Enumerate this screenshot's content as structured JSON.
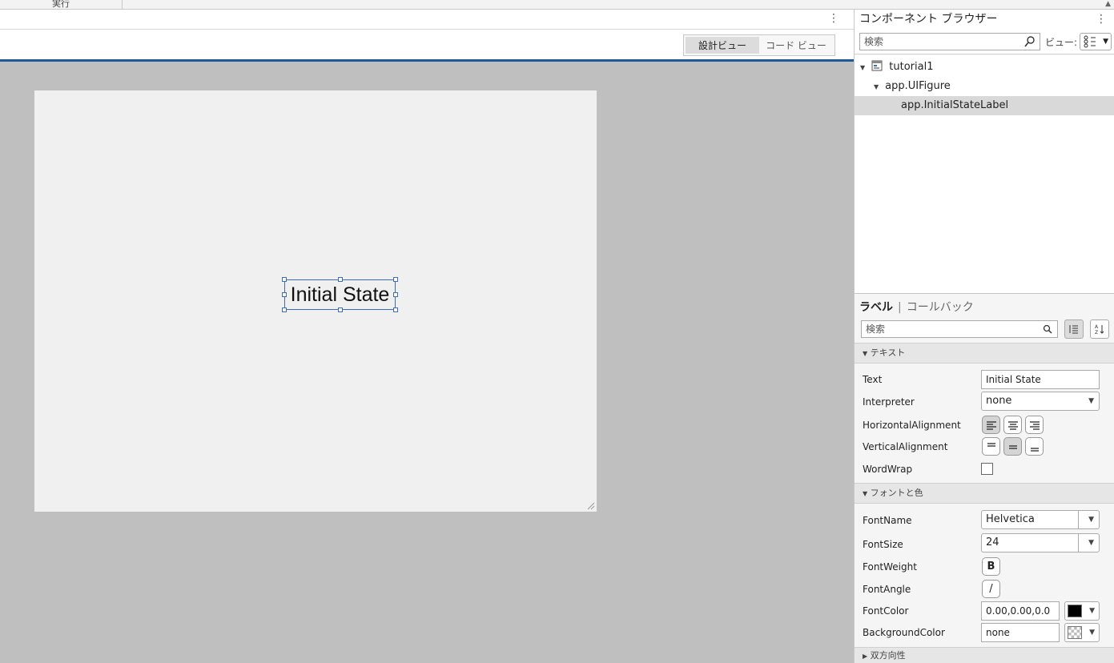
{
  "top": {
    "run_tab": "実行"
  },
  "editor": {
    "view_toggle": {
      "design": "設計ビュー",
      "code": "コード ビュー"
    },
    "canvas": {
      "label_text": "Initial State"
    }
  },
  "component_browser": {
    "title": "コンポーネント ブラウザー",
    "search_placeholder": "検索",
    "view_label": "ビュー:",
    "tree": [
      {
        "label": "tutorial1"
      },
      {
        "label": "app.UIFigure"
      },
      {
        "label": "app.InitialStateLabel"
      }
    ]
  },
  "inspector": {
    "tab_active": "ラベル",
    "tab_inactive": "コールバック",
    "search_placeholder": "検索",
    "sections": {
      "text": "テキスト",
      "font": "フォントと色",
      "bidi": "双方向性"
    },
    "props": {
      "text_label": "Text",
      "text_value": "Initial State",
      "interpreter_label": "Interpreter",
      "interpreter_value": "none",
      "halign_label": "HorizontalAlignment",
      "valign_label": "VerticalAlignment",
      "wordwrap_label": "WordWrap",
      "fontname_label": "FontName",
      "fontname_value": "Helvetica",
      "fontsize_label": "FontSize",
      "fontsize_value": "24",
      "fontweight_label": "FontWeight",
      "fontweight_glyph": "B",
      "fontangle_label": "FontAngle",
      "fontangle_glyph": "/",
      "fontcolor_label": "FontColor",
      "fontcolor_value": "0.00,0.00,0.0",
      "bgcolor_label": "BackgroundColor",
      "bgcolor_value": "none"
    }
  },
  "colors": {
    "accent": "#1f5a96",
    "selection": "#3b6cc0"
  }
}
